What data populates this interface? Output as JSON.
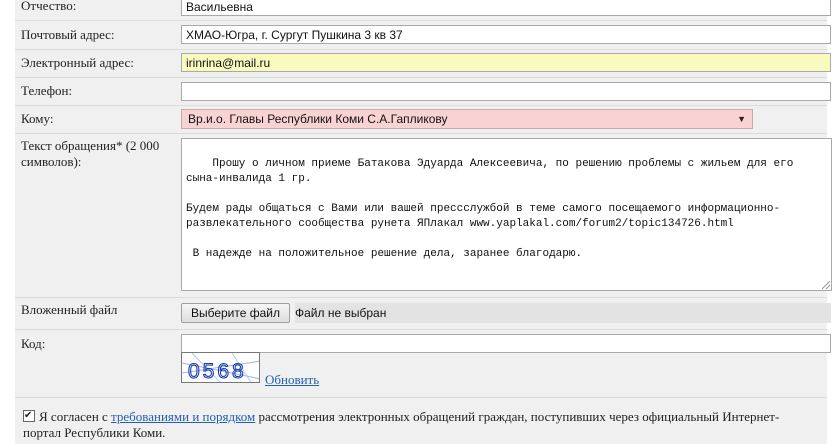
{
  "fields": {
    "patronymic": {
      "label": "Отчество:",
      "value": "Васильевна"
    },
    "postal": {
      "label": "Почтовый адрес:",
      "value": "ХМАО-Югра, г. Сургут Пушкина 3 кв 37"
    },
    "email": {
      "label": "Электронный адрес:",
      "value": "irinrina@mail.ru"
    },
    "phone": {
      "label": "Телефон:",
      "value": ""
    },
    "to": {
      "label": "Кому:",
      "value": "Вр.и.о. Главы Республики Коми С.А.Гапликову"
    },
    "message": {
      "label": "Текст обращения* (2 000 символов):",
      "value": "Прошу о личном приеме Батакова Эдуарда Алексеевича, по решению проблемы с жильем для его сына-инвалида 1 гр.\n\nБудем рады общаться с Вами или вашей прессслужбой в теме самого посещаемого информационно-развлекательного сообщества рунета ЯПлакал www.yaplakal.com/forum2/topic134726.html\n\n В надежде на положительное решение дела, заранее благодарю."
    },
    "attachment": {
      "label": "Вложенный файл",
      "button": "Выберите файл",
      "status": "Файл не выбран"
    },
    "code": {
      "label": "Код:",
      "value": "",
      "captcha_text": "0568",
      "refresh": "Обновить"
    }
  },
  "agreement": {
    "checked": true,
    "text_before": "Я согласен с ",
    "link": "требованиями и порядком",
    "text_after": " рассмотрения электронных обращений граждан, поступивших через официальный Интернет-портал Республики Коми."
  },
  "colors": {
    "email_bg": "#fafabf",
    "select_bg": "#f9d3d1",
    "link": "#2060b0"
  }
}
